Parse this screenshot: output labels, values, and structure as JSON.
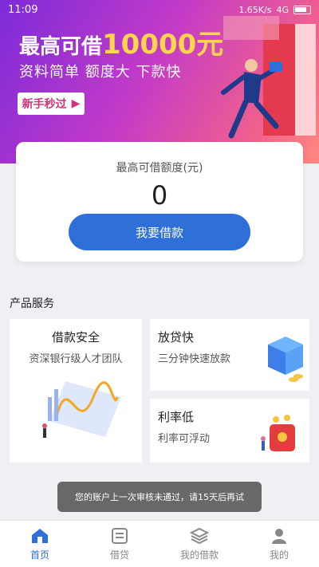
{
  "status": {
    "time": "11:09",
    "speed": "1.65K/s",
    "network": "4G"
  },
  "hero": {
    "title_prefix": "最高可借",
    "title_amount": "10000元",
    "subtitle": "资料简单  额度大  下款快",
    "newbie_label": "新手秒过"
  },
  "amount_card": {
    "label": "最高可借额度(元)",
    "value": "0",
    "button": "我要借款"
  },
  "products": {
    "section_title": "产品服务",
    "items": [
      {
        "title": "借款安全",
        "subtitle": "资深银行级人才团队"
      },
      {
        "title": "放贷快",
        "subtitle": "三分钟快速放款"
      },
      {
        "title": "利率低",
        "subtitle": "利率可浮动"
      }
    ]
  },
  "toast": "您的账户上一次审核未通过，请15天后再试",
  "tabs": [
    {
      "label": "首页",
      "icon": "home-icon",
      "active": true
    },
    {
      "label": "借贷",
      "icon": "loan-icon",
      "active": false
    },
    {
      "label": "我的借款",
      "icon": "layers-icon",
      "active": false
    },
    {
      "label": "我的",
      "icon": "profile-icon",
      "active": false
    }
  ],
  "colors": {
    "primary": "#2e6fd8",
    "accent": "#ffd54a"
  }
}
